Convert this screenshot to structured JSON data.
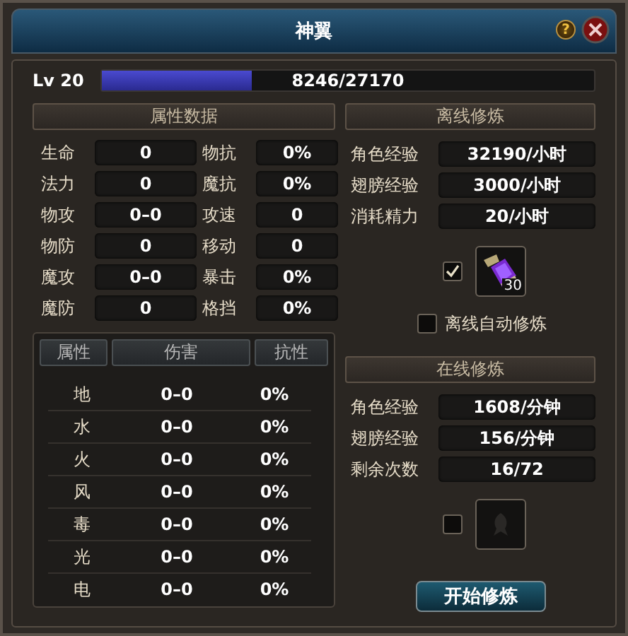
{
  "window": {
    "title": "神翼",
    "help": "?"
  },
  "level": {
    "label": "Lv 20",
    "level": 0.304,
    "reading": "8246/27170"
  },
  "attributes": {
    "title": "属性数据",
    "items": [
      {
        "label": "生命",
        "value": "0"
      },
      {
        "label": "物抗",
        "value": "0%"
      },
      {
        "label": "法力",
        "value": "0"
      },
      {
        "label": "魔抗",
        "value": "0%"
      },
      {
        "label": "物攻",
        "value": "0–0"
      },
      {
        "label": "攻速",
        "value": "0"
      },
      {
        "label": "物防",
        "value": "0"
      },
      {
        "label": "移动",
        "value": "0"
      },
      {
        "label": "魔攻",
        "value": "0–0"
      },
      {
        "label": "暴击",
        "value": "0%"
      },
      {
        "label": "魔防",
        "value": "0"
      },
      {
        "label": "格挡",
        "value": "0%"
      }
    ]
  },
  "elements": {
    "columns": [
      "属性",
      "伤害",
      "抗性"
    ],
    "rows": [
      [
        "地",
        "0–0",
        "0%"
      ],
      [
        "水",
        "0–0",
        "0%"
      ],
      [
        "火",
        "0–0",
        "0%"
      ],
      [
        "风",
        "0–0",
        "0%"
      ],
      [
        "毒",
        "0–0",
        "0%"
      ],
      [
        "光",
        "0–0",
        "0%"
      ],
      [
        "电",
        "0–0",
        "0%"
      ]
    ]
  },
  "offline": {
    "title": "离线修炼",
    "stats": [
      {
        "label": "角色经验",
        "value": "32190/小时"
      },
      {
        "label": "翅膀经验",
        "value": "3000/小时"
      },
      {
        "label": "消耗精力",
        "value": "20/小时"
      }
    ],
    "item": {
      "checked": true,
      "count": "30"
    },
    "auto": {
      "label": "离线自动修炼",
      "checked": false
    }
  },
  "online": {
    "title": "在线修炼",
    "stats": [
      {
        "label": "角色经验",
        "value": "1608/分钟"
      },
      {
        "label": "翅膀经验",
        "value": "156/分钟"
      },
      {
        "label": "剩余次数",
        "value": "16/72"
      }
    ],
    "slot": {
      "checked": false
    },
    "button": "开始修炼"
  }
}
